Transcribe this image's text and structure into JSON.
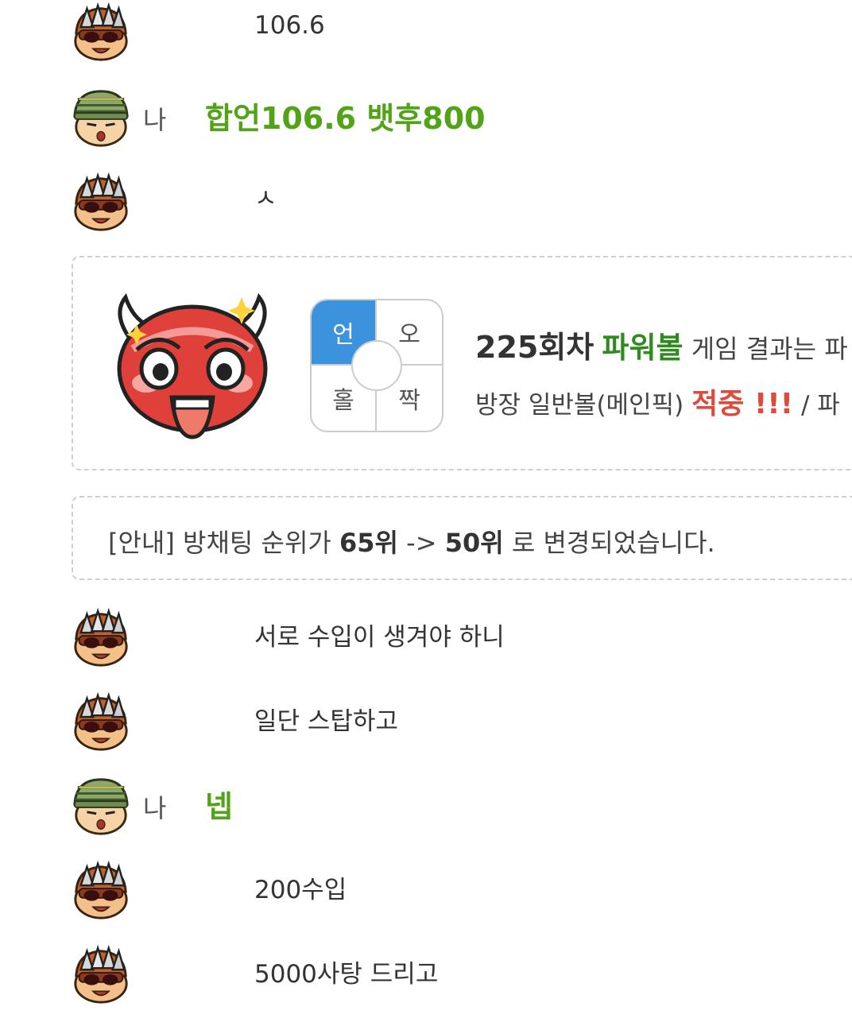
{
  "messages": [
    {
      "sender": "other",
      "text": "106.6"
    },
    {
      "sender": "me",
      "label": "나",
      "text": "합언106.6 뱃후800"
    },
    {
      "sender": "other",
      "text": "ㅅ"
    },
    {
      "sender": "other",
      "text": "서로 수입이 생겨야 하니"
    },
    {
      "sender": "other",
      "text": "일단 스탑하고"
    },
    {
      "sender": "me",
      "label": "나",
      "text": "넵"
    },
    {
      "sender": "other",
      "text": "200수입"
    },
    {
      "sender": "other",
      "text": "5000사탕 드리고"
    }
  ],
  "result_card": {
    "pick_cells": {
      "top_left": "언",
      "top_right": "오",
      "bottom_left": "홀",
      "bottom_right": "짝"
    },
    "selected_cell": "top_left",
    "round": "225회차",
    "game": "파워볼",
    "result_suffix": " 게임 결과는 파",
    "line2_prefix": "방장 일반볼(메인픽) ",
    "hit_text": "적중 !!!",
    "line2_suffix": " / 파"
  },
  "notice": {
    "prefix": "[안내] 방채팅 순위가 ",
    "from_rank": "65위",
    "arrow": " -> ",
    "to_rank": "50위",
    "suffix": " 로 변경되었습니다."
  },
  "colors": {
    "my_message": "#52a318",
    "game_name": "#2f8a1f",
    "hit": "#e04a3a",
    "selected_cell": "#3b93dd"
  },
  "icons": {
    "other_avatar": "spiky-helmet-avatar-icon",
    "my_avatar": "green-cap-avatar-icon",
    "result_mascot": "red-devil-mascot-icon"
  }
}
